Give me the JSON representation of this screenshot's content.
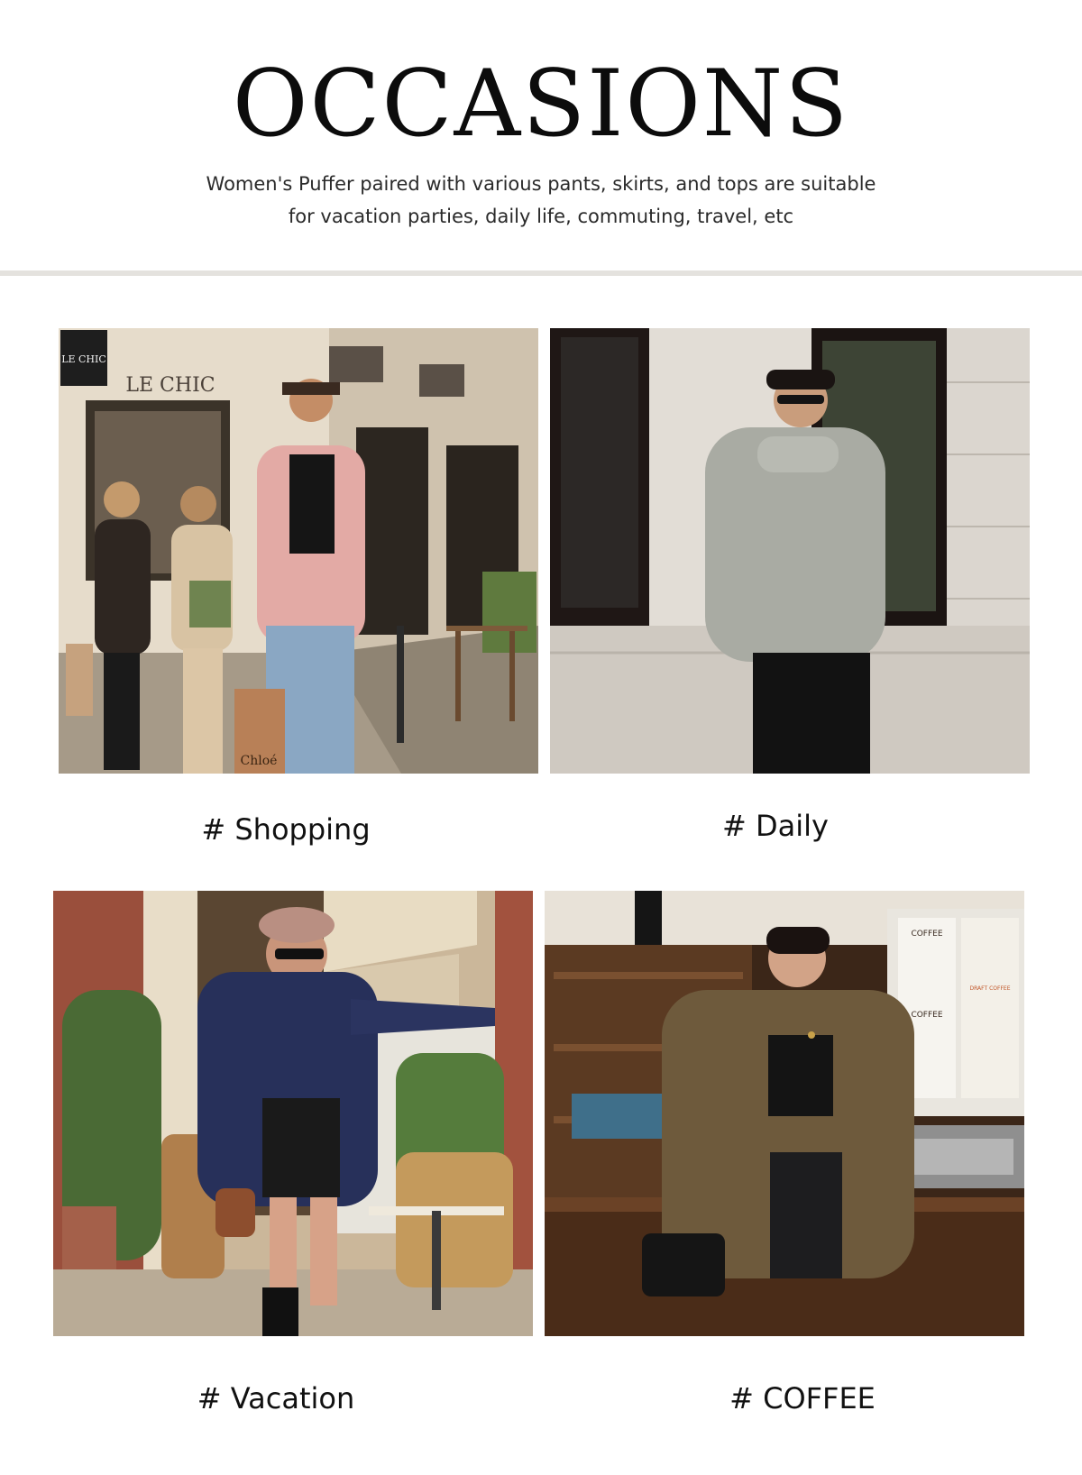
{
  "header": {
    "title": "OCCASIONS",
    "subtitle_line1": "Women's Puffer paired with various pants, skirts, and tops are suitable",
    "subtitle_line2": "for vacation parties, daily life, commuting, travel, etc"
  },
  "occasions": [
    {
      "caption": "# Shopping",
      "jacket_color": "#e3aaa5",
      "sign_text": "LE CHIC",
      "bag_text": "Chloé"
    },
    {
      "caption": "# Daily",
      "jacket_color": "#a9aba3"
    },
    {
      "caption": "# Vacation",
      "jacket_color": "#27305a"
    },
    {
      "caption": "# COFFEE",
      "jacket_color": "#6e5a3c",
      "menu_text": "COFFEE",
      "menu_text_2": "COFFEE",
      "menu_text_3": "DRAFT COFFEE"
    }
  ],
  "colors": {
    "background": "#ffffff",
    "divider": "#e4e2de",
    "text": "#111111"
  }
}
